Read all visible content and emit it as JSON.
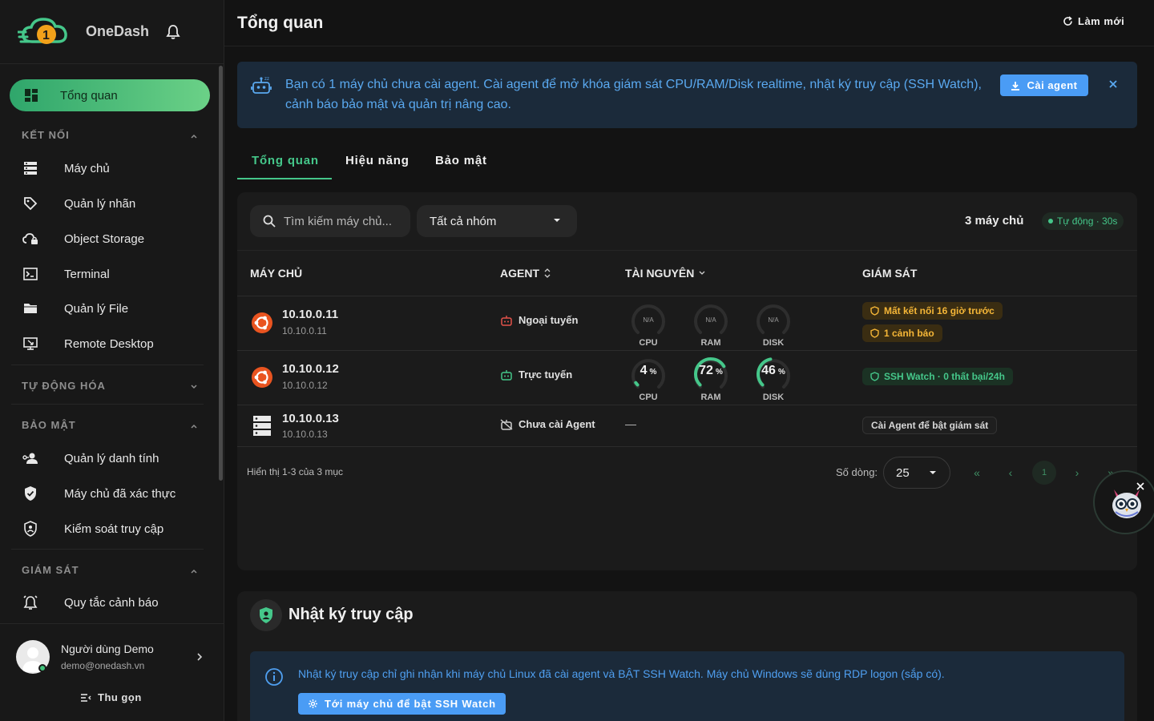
{
  "app": {
    "brand": "OneDash"
  },
  "sidebar": {
    "active_item": {
      "label": "Tổng quan"
    },
    "sections": {
      "connect": "KẾT NỐI",
      "automation": "TỰ ĐỘNG HÓA",
      "security": "BẢO MẬT",
      "monitoring": "GIÁM SÁT"
    },
    "connect_items": [
      {
        "label": "Máy chủ",
        "icon": "server-icon"
      },
      {
        "label": "Quản lý nhãn",
        "icon": "tag-icon"
      },
      {
        "label": "Object Storage",
        "icon": "cloud-lock-icon"
      },
      {
        "label": "Terminal",
        "icon": "terminal-icon"
      },
      {
        "label": "Quản lý File",
        "icon": "folder-icon"
      },
      {
        "label": "Remote Desktop",
        "icon": "remote-desktop-icon"
      }
    ],
    "security_items": [
      {
        "label": "Quản lý danh tính",
        "icon": "identity-icon"
      },
      {
        "label": "Máy chủ đã xác thực",
        "icon": "verified-shield-icon"
      },
      {
        "label": "Kiểm soát truy cập",
        "icon": "access-shield-icon"
      }
    ],
    "monitoring_items": [
      {
        "label": "Quy tắc cảnh báo",
        "icon": "alarm-icon"
      }
    ],
    "user": {
      "name": "Người dùng Demo",
      "email": "demo@onedash.vn"
    },
    "collapse_label": "Thu gọn"
  },
  "header": {
    "title": "Tổng quan",
    "refresh_label": "Làm mới"
  },
  "banner": {
    "text": "Bạn có 1 máy chủ chưa cài agent. Cài agent để mở khóa giám sát CPU/RAM/Disk realtime, nhật ký truy cập (SSH Watch), cảnh báo bảo mật và quản trị nâng cao.",
    "button_label": "Cài agent"
  },
  "tabs": [
    {
      "label": "Tổng quan",
      "active": true
    },
    {
      "label": "Hiệu năng",
      "active": false
    },
    {
      "label": "Bảo mật",
      "active": false
    }
  ],
  "filters": {
    "search_placeholder": "Tìm kiếm máy chủ...",
    "group_value": "Tất cả nhóm",
    "server_count": "3 máy chủ",
    "auto_refresh": "Tự động · 30s"
  },
  "table": {
    "columns": {
      "server": "MÁY CHỦ",
      "agent": "AGENT",
      "resources": "TÀI NGUYÊN",
      "monitoring": "GIÁM SÁT"
    },
    "gauge_labels": {
      "cpu": "CPU",
      "ram": "RAM",
      "disk": "DISK",
      "na": "N/A",
      "unit": "%"
    },
    "rows": [
      {
        "name": "10.10.0.11",
        "ip": "10.10.0.11",
        "os": "ubuntu",
        "agent": "Ngoại tuyến",
        "cpu": null,
        "ram": null,
        "disk": null,
        "alerts": [
          "Mất kết nối 16 giờ trước",
          "1 cảnh báo"
        ]
      },
      {
        "name": "10.10.0.12",
        "ip": "10.10.0.12",
        "os": "ubuntu",
        "agent": "Trực tuyến",
        "cpu": 4,
        "ram": 72,
        "disk": 46,
        "alerts": [
          "SSH Watch · 0 thất bại/24h"
        ]
      },
      {
        "name": "10.10.0.13",
        "ip": "10.10.0.13",
        "os": "server",
        "agent": "Chưa cài Agent",
        "resources_placeholder": "—",
        "alerts": [
          "Cài Agent để bật giám sát"
        ]
      }
    ]
  },
  "pagination": {
    "info": "Hiển thị 1-3 của 3 mục",
    "rows_label": "Số dòng:",
    "rows_value": "25",
    "first": "«",
    "prev": "‹",
    "current": "1",
    "next": "›",
    "last": "»"
  },
  "access_log": {
    "title": "Nhật ký truy cập",
    "info": "Nhật ký truy cập chỉ ghi nhận khi máy chủ Linux đã cài agent và BẬT SSH Watch. Máy chủ Windows sẽ dùng RDP logon (sắp có).",
    "button_label": "Tới máy chủ để bật SSH Watch"
  },
  "colors": {
    "accent": "#45c78a",
    "info": "#4a9cf5",
    "warning": "#f5b637",
    "background": "#131313",
    "surface": "#1b1b1b",
    "banner_bg": "#1b2a3a"
  }
}
